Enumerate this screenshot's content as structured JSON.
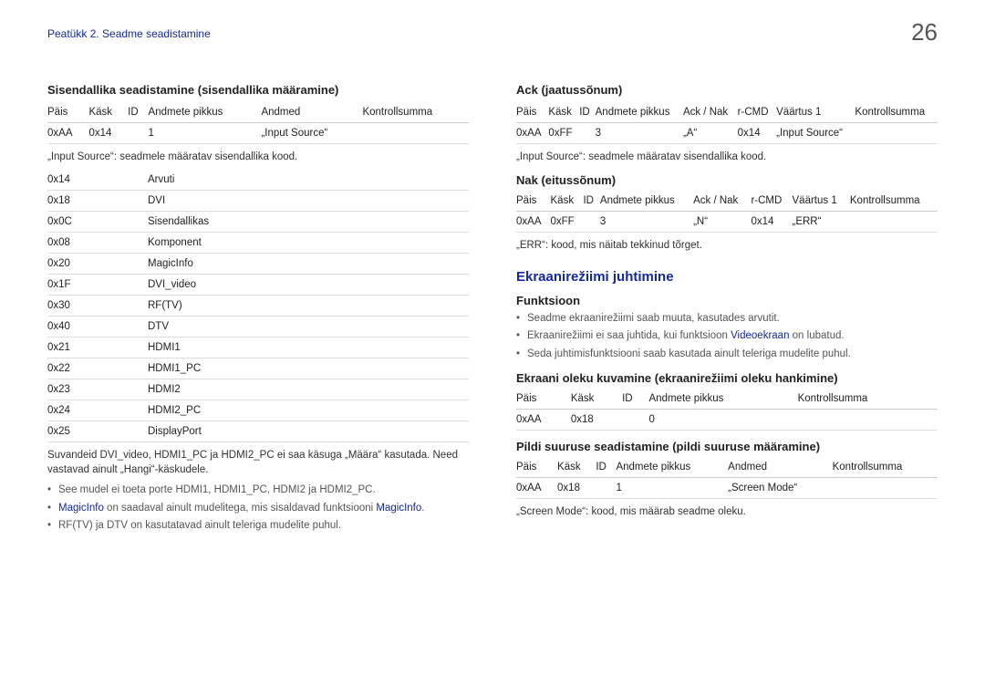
{
  "header": {
    "breadcrumb": "Peatükk 2. Seadme seadistamine",
    "pageNumber": "26"
  },
  "left": {
    "title": "Sisendallika seadistamine (sisendallika määramine)",
    "table1": {
      "headers": [
        "Päis",
        "Käsk",
        "ID",
        "Andmete pikkus",
        "Andmed",
        "Kontrollsumma"
      ],
      "row": [
        "0xAA",
        "0x14",
        "",
        "1",
        "„Input Source“",
        ""
      ]
    },
    "note1": "„Input Source“: seadmele määratav sisendallika kood.",
    "codes": [
      [
        "0x14",
        "Arvuti"
      ],
      [
        "0x18",
        "DVI"
      ],
      [
        "0x0C",
        "Sisendallikas"
      ],
      [
        "0x08",
        "Komponent"
      ],
      [
        "0x20",
        "MagicInfo"
      ],
      [
        "0x1F",
        "DVI_video"
      ],
      [
        "0x30",
        "RF(TV)"
      ],
      [
        "0x40",
        "DTV"
      ],
      [
        "0x21",
        "HDMI1"
      ],
      [
        "0x22",
        "HDMI1_PC"
      ],
      [
        "0x23",
        "HDMI2"
      ],
      [
        "0x24",
        "HDMI2_PC"
      ],
      [
        "0x25",
        "DisplayPort"
      ]
    ],
    "note2": "Suvandeid DVI_video, HDMI1_PC ja HDMI2_PC ei saa käsuga „Määra“ kasutada. Need vastavad ainult „Hangi“-käskudele.",
    "bullets": {
      "b1": "See mudel ei toeta porte HDMI1, HDMI1_PC, HDMI2 ja HDMI2_PC.",
      "b2_a": "MagicInfo",
      "b2_b": " on saadaval ainult mudelitega, mis sisaldavad funktsiooni ",
      "b2_c": "MagicInfo",
      "b2_d": ".",
      "b3": "RF(TV) ja DTV on kasutatavad ainult teleriga mudelite puhul."
    }
  },
  "right": {
    "ackTitle": "Ack (jaatussõnum)",
    "ackTable": {
      "headers": [
        "Päis",
        "Käsk",
        "ID",
        "Andmete pikkus",
        "Ack / Nak",
        "r-CMD",
        "Väärtus 1",
        "Kontrollsumma"
      ],
      "row": [
        "0xAA",
        "0xFF",
        "",
        "3",
        "„A“",
        "0x14",
        "„Input Source“",
        ""
      ]
    },
    "ackNote": "„Input Source“: seadmele määratav sisendallika kood.",
    "nakTitle": "Nak (eitussõnum)",
    "nakTable": {
      "headers": [
        "Päis",
        "Käsk",
        "ID",
        "Andmete pikkus",
        "Ack / Nak",
        "r-CMD",
        "Väärtus 1",
        "Kontrollsumma"
      ],
      "row": [
        "0xAA",
        "0xFF",
        "",
        "3",
        "„N“",
        "0x14",
        "„ERR“",
        ""
      ]
    },
    "nakNote": "„ERR“: kood, mis näitab tekkinud tõrget.",
    "blueTitle": "Ekraanirežiimi juhtimine",
    "funkTitle": "Funktsioon",
    "funkBullets": {
      "b1": "Seadme ekraanirežiimi saab muuta, kasutades arvutit.",
      "b2_a": "Ekraanirežiimi ei saa juhtida, kui funktsioon ",
      "b2_b": "Videoekraan",
      "b2_c": " on lubatud.",
      "b3": "Seda juhtimisfunktsiooni saab kasutada ainult teleriga mudelite puhul."
    },
    "getTitle": "Ekraani oleku kuvamine (ekraanirežiimi oleku hankimine)",
    "getTable": {
      "headers": [
        "Päis",
        "Käsk",
        "ID",
        "Andmete pikkus",
        "Kontrollsumma"
      ],
      "row": [
        "0xAA",
        "0x18",
        "",
        "0",
        ""
      ]
    },
    "setTitle": "Pildi suuruse seadistamine (pildi suuruse määramine)",
    "setTable": {
      "headers": [
        "Päis",
        "Käsk",
        "ID",
        "Andmete pikkus",
        "Andmed",
        "Kontrollsumma"
      ],
      "row": [
        "0xAA",
        "0x18",
        "",
        "1",
        "„Screen Mode“",
        ""
      ]
    },
    "setNote": "„Screen Mode“: kood, mis määrab seadme oleku."
  }
}
